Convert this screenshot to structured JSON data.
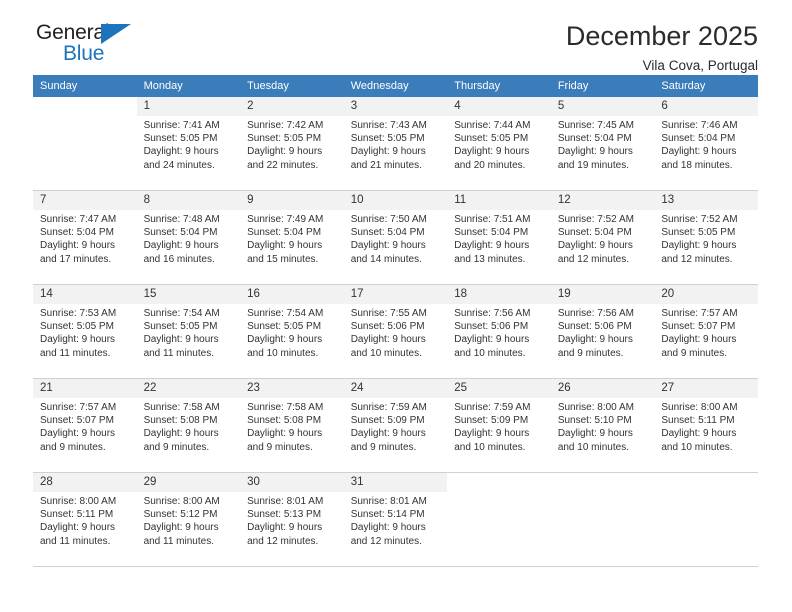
{
  "brand": {
    "name_top": "General",
    "name_bottom": "Blue",
    "triangle_color": "#1c75bc",
    "text_color": "#231f20"
  },
  "header": {
    "title": "December 2025",
    "subtitle": "Vila Cova, Portugal"
  },
  "theme": {
    "header_row_bg": "#3b7cba",
    "header_row_text": "#ffffff",
    "daynum_bg": "#f2f2f2",
    "cell_text": "#333333",
    "separator": "#d0d0d0"
  },
  "weekday_headers": [
    "Sunday",
    "Monday",
    "Tuesday",
    "Wednesday",
    "Thursday",
    "Friday",
    "Saturday"
  ],
  "weeks": [
    {
      "days": [
        {
          "num": "",
          "sunrise": "",
          "sunset": "",
          "daylight1": "",
          "daylight2": "",
          "empty": true
        },
        {
          "num": "1",
          "sunrise": "Sunrise: 7:41 AM",
          "sunset": "Sunset: 5:05 PM",
          "daylight1": "Daylight: 9 hours",
          "daylight2": "and 24 minutes.",
          "empty": false
        },
        {
          "num": "2",
          "sunrise": "Sunrise: 7:42 AM",
          "sunset": "Sunset: 5:05 PM",
          "daylight1": "Daylight: 9 hours",
          "daylight2": "and 22 minutes.",
          "empty": false
        },
        {
          "num": "3",
          "sunrise": "Sunrise: 7:43 AM",
          "sunset": "Sunset: 5:05 PM",
          "daylight1": "Daylight: 9 hours",
          "daylight2": "and 21 minutes.",
          "empty": false
        },
        {
          "num": "4",
          "sunrise": "Sunrise: 7:44 AM",
          "sunset": "Sunset: 5:05 PM",
          "daylight1": "Daylight: 9 hours",
          "daylight2": "and 20 minutes.",
          "empty": false
        },
        {
          "num": "5",
          "sunrise": "Sunrise: 7:45 AM",
          "sunset": "Sunset: 5:04 PM",
          "daylight1": "Daylight: 9 hours",
          "daylight2": "and 19 minutes.",
          "empty": false
        },
        {
          "num": "6",
          "sunrise": "Sunrise: 7:46 AM",
          "sunset": "Sunset: 5:04 PM",
          "daylight1": "Daylight: 9 hours",
          "daylight2": "and 18 minutes.",
          "empty": false
        }
      ]
    },
    {
      "days": [
        {
          "num": "7",
          "sunrise": "Sunrise: 7:47 AM",
          "sunset": "Sunset: 5:04 PM",
          "daylight1": "Daylight: 9 hours",
          "daylight2": "and 17 minutes.",
          "empty": false
        },
        {
          "num": "8",
          "sunrise": "Sunrise: 7:48 AM",
          "sunset": "Sunset: 5:04 PM",
          "daylight1": "Daylight: 9 hours",
          "daylight2": "and 16 minutes.",
          "empty": false
        },
        {
          "num": "9",
          "sunrise": "Sunrise: 7:49 AM",
          "sunset": "Sunset: 5:04 PM",
          "daylight1": "Daylight: 9 hours",
          "daylight2": "and 15 minutes.",
          "empty": false
        },
        {
          "num": "10",
          "sunrise": "Sunrise: 7:50 AM",
          "sunset": "Sunset: 5:04 PM",
          "daylight1": "Daylight: 9 hours",
          "daylight2": "and 14 minutes.",
          "empty": false
        },
        {
          "num": "11",
          "sunrise": "Sunrise: 7:51 AM",
          "sunset": "Sunset: 5:04 PM",
          "daylight1": "Daylight: 9 hours",
          "daylight2": "and 13 minutes.",
          "empty": false
        },
        {
          "num": "12",
          "sunrise": "Sunrise: 7:52 AM",
          "sunset": "Sunset: 5:04 PM",
          "daylight1": "Daylight: 9 hours",
          "daylight2": "and 12 minutes.",
          "empty": false
        },
        {
          "num": "13",
          "sunrise": "Sunrise: 7:52 AM",
          "sunset": "Sunset: 5:05 PM",
          "daylight1": "Daylight: 9 hours",
          "daylight2": "and 12 minutes.",
          "empty": false
        }
      ]
    },
    {
      "days": [
        {
          "num": "14",
          "sunrise": "Sunrise: 7:53 AM",
          "sunset": "Sunset: 5:05 PM",
          "daylight1": "Daylight: 9 hours",
          "daylight2": "and 11 minutes.",
          "empty": false
        },
        {
          "num": "15",
          "sunrise": "Sunrise: 7:54 AM",
          "sunset": "Sunset: 5:05 PM",
          "daylight1": "Daylight: 9 hours",
          "daylight2": "and 11 minutes.",
          "empty": false
        },
        {
          "num": "16",
          "sunrise": "Sunrise: 7:54 AM",
          "sunset": "Sunset: 5:05 PM",
          "daylight1": "Daylight: 9 hours",
          "daylight2": "and 10 minutes.",
          "empty": false
        },
        {
          "num": "17",
          "sunrise": "Sunrise: 7:55 AM",
          "sunset": "Sunset: 5:06 PM",
          "daylight1": "Daylight: 9 hours",
          "daylight2": "and 10 minutes.",
          "empty": false
        },
        {
          "num": "18",
          "sunrise": "Sunrise: 7:56 AM",
          "sunset": "Sunset: 5:06 PM",
          "daylight1": "Daylight: 9 hours",
          "daylight2": "and 10 minutes.",
          "empty": false
        },
        {
          "num": "19",
          "sunrise": "Sunrise: 7:56 AM",
          "sunset": "Sunset: 5:06 PM",
          "daylight1": "Daylight: 9 hours",
          "daylight2": "and 9 minutes.",
          "empty": false
        },
        {
          "num": "20",
          "sunrise": "Sunrise: 7:57 AM",
          "sunset": "Sunset: 5:07 PM",
          "daylight1": "Daylight: 9 hours",
          "daylight2": "and 9 minutes.",
          "empty": false
        }
      ]
    },
    {
      "days": [
        {
          "num": "21",
          "sunrise": "Sunrise: 7:57 AM",
          "sunset": "Sunset: 5:07 PM",
          "daylight1": "Daylight: 9 hours",
          "daylight2": "and 9 minutes.",
          "empty": false
        },
        {
          "num": "22",
          "sunrise": "Sunrise: 7:58 AM",
          "sunset": "Sunset: 5:08 PM",
          "daylight1": "Daylight: 9 hours",
          "daylight2": "and 9 minutes.",
          "empty": false
        },
        {
          "num": "23",
          "sunrise": "Sunrise: 7:58 AM",
          "sunset": "Sunset: 5:08 PM",
          "daylight1": "Daylight: 9 hours",
          "daylight2": "and 9 minutes.",
          "empty": false
        },
        {
          "num": "24",
          "sunrise": "Sunrise: 7:59 AM",
          "sunset": "Sunset: 5:09 PM",
          "daylight1": "Daylight: 9 hours",
          "daylight2": "and 9 minutes.",
          "empty": false
        },
        {
          "num": "25",
          "sunrise": "Sunrise: 7:59 AM",
          "sunset": "Sunset: 5:09 PM",
          "daylight1": "Daylight: 9 hours",
          "daylight2": "and 10 minutes.",
          "empty": false
        },
        {
          "num": "26",
          "sunrise": "Sunrise: 8:00 AM",
          "sunset": "Sunset: 5:10 PM",
          "daylight1": "Daylight: 9 hours",
          "daylight2": "and 10 minutes.",
          "empty": false
        },
        {
          "num": "27",
          "sunrise": "Sunrise: 8:00 AM",
          "sunset": "Sunset: 5:11 PM",
          "daylight1": "Daylight: 9 hours",
          "daylight2": "and 10 minutes.",
          "empty": false
        }
      ]
    },
    {
      "days": [
        {
          "num": "28",
          "sunrise": "Sunrise: 8:00 AM",
          "sunset": "Sunset: 5:11 PM",
          "daylight1": "Daylight: 9 hours",
          "daylight2": "and 11 minutes.",
          "empty": false
        },
        {
          "num": "29",
          "sunrise": "Sunrise: 8:00 AM",
          "sunset": "Sunset: 5:12 PM",
          "daylight1": "Daylight: 9 hours",
          "daylight2": "and 11 minutes.",
          "empty": false
        },
        {
          "num": "30",
          "sunrise": "Sunrise: 8:01 AM",
          "sunset": "Sunset: 5:13 PM",
          "daylight1": "Daylight: 9 hours",
          "daylight2": "and 12 minutes.",
          "empty": false
        },
        {
          "num": "31",
          "sunrise": "Sunrise: 8:01 AM",
          "sunset": "Sunset: 5:14 PM",
          "daylight1": "Daylight: 9 hours",
          "daylight2": "and 12 minutes.",
          "empty": false
        },
        {
          "num": "",
          "sunrise": "",
          "sunset": "",
          "daylight1": "",
          "daylight2": "",
          "empty": true
        },
        {
          "num": "",
          "sunrise": "",
          "sunset": "",
          "daylight1": "",
          "daylight2": "",
          "empty": true
        },
        {
          "num": "",
          "sunrise": "",
          "sunset": "",
          "daylight1": "",
          "daylight2": "",
          "empty": true
        }
      ]
    }
  ]
}
